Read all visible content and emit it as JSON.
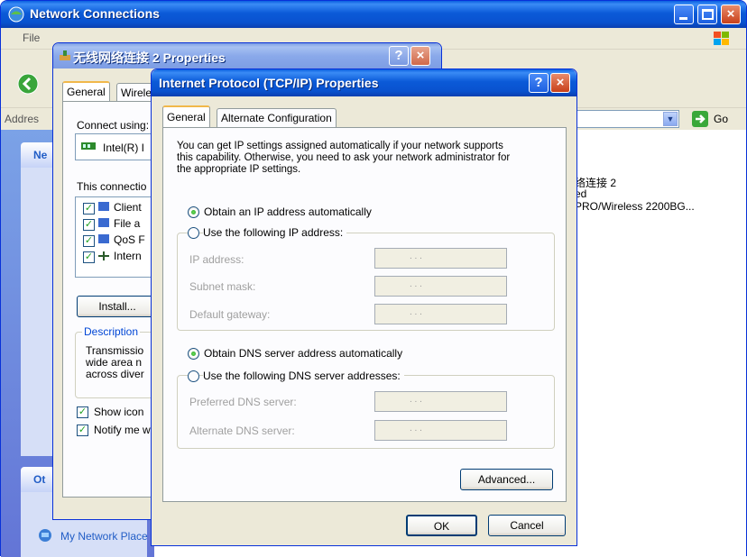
{
  "network_window": {
    "title": "Network Connections",
    "menu_file": "File",
    "address_label": "Addres",
    "go_label": "Go",
    "sidebar_header": "Ne",
    "sidebar_other": "Ot",
    "sidebar_my_network": "My Network Place",
    "item_name": "络连接 2",
    "item_status": "ed",
    "item_device": "PRO/Wireless 2200BG..."
  },
  "wireless_props": {
    "title": "无线网络连接 2 Properties",
    "tab_general": "General",
    "tab_wireless": "Wirele",
    "connect_using": "Connect using:",
    "adapter": "Intel(R) I",
    "this_connection": "This connectio",
    "components": [
      "Client",
      "File a",
      "QoS F",
      "Intern"
    ],
    "install_button": "Install...",
    "description_legend": "Description",
    "description_lines": [
      "Transmissio",
      "wide area n",
      "across diver"
    ],
    "show_icon": "Show icon",
    "notify_me": "Notify me w"
  },
  "tcpip": {
    "title": "Internet Protocol (TCP/IP) Properties",
    "help_button": "?",
    "close_button": "×",
    "tabs": [
      "General",
      "Alternate Configuration"
    ],
    "intro_line1": "You can get IP settings assigned automatically if your network supports",
    "intro_line2": "this capability. Otherwise, you need to ask your network administrator for",
    "intro_line3": "the appropriate IP settings.",
    "ip_auto": "Obtain an IP address automatically",
    "ip_manual": "Use the following IP address:",
    "ip_address_label": "IP address:",
    "subnet_label": "Subnet mask:",
    "gateway_label": "Default gateway:",
    "dns_auto": "Obtain DNS server address automatically",
    "dns_manual": "Use the following DNS server addresses:",
    "preferred_dns_label": "Preferred DNS server:",
    "alternate_dns_label": "Alternate DNS server:",
    "ip_dots": ".       .       .",
    "advanced_button": "Advanced...",
    "ok_button": "OK",
    "cancel_button": "Cancel"
  },
  "colors": {
    "xp_blue": "#0b5ad8",
    "dialog_bg": "#ece9d8",
    "legend_blue": "#0046d5"
  },
  "icons": [
    "network-connections-icon",
    "back-icon",
    "windows-flag-icon",
    "go-arrow-icon",
    "adapter-icon",
    "help-icon",
    "close-icon",
    "minimize-icon",
    "maximize-icon"
  ]
}
